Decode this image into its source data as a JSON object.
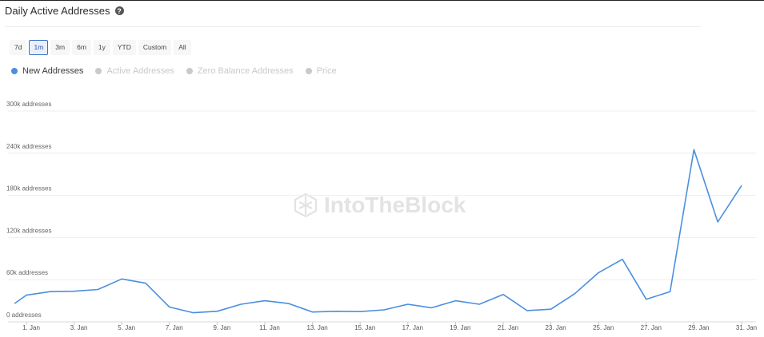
{
  "header": {
    "title": "Daily Active Addresses",
    "help_icon": "question-circle-icon",
    "help_glyph": "?"
  },
  "range_buttons": [
    {
      "label": "7d",
      "active": false
    },
    {
      "label": "1m",
      "active": true
    },
    {
      "label": "3m",
      "active": false
    },
    {
      "label": "6m",
      "active": false
    },
    {
      "label": "1y",
      "active": false
    },
    {
      "label": "YTD",
      "active": false
    },
    {
      "label": "Custom",
      "active": false
    },
    {
      "label": "All",
      "active": false
    }
  ],
  "legend": [
    {
      "label": "New Addresses",
      "color": "#4a8fe0",
      "active": true
    },
    {
      "label": "Active Addresses",
      "color": "#c9c9c9",
      "active": false
    },
    {
      "label": "Zero Balance Addresses",
      "color": "#c9c9c9",
      "active": false
    },
    {
      "label": "Price",
      "color": "#c9c9c9",
      "active": false
    }
  ],
  "watermark": {
    "text": "IntoTheBlock",
    "icon": "intotheblock-logo-icon"
  },
  "chart_data": {
    "type": "line",
    "title": "",
    "xlabel": "",
    "ylabel": "",
    "ylim": [
      0,
      300000
    ],
    "y_ticks": [
      {
        "value": 0,
        "label": "0 addresses"
      },
      {
        "value": 60000,
        "label": "60k addresses"
      },
      {
        "value": 120000,
        "label": "120k addresses"
      },
      {
        "value": 180000,
        "label": "180k addresses"
      },
      {
        "value": 240000,
        "label": "240k addresses"
      },
      {
        "value": 300000,
        "label": "300k addresses"
      }
    ],
    "x_tick_labels": [
      "1. Jan",
      "3. Jan",
      "5. Jan",
      "7. Jan",
      "9. Jan",
      "11. Jan",
      "13. Jan",
      "15. Jan",
      "17. Jan",
      "19. Jan",
      "21. Jan",
      "23. Jan",
      "25. Jan",
      "27. Jan",
      "29. Jan",
      "31. Jan"
    ],
    "x_tick_days": [
      1,
      3,
      5,
      7,
      9,
      11,
      13,
      15,
      17,
      19,
      21,
      23,
      25,
      27,
      29,
      31
    ],
    "grid": true,
    "series": [
      {
        "name": "New Addresses",
        "color": "#4a8fe0",
        "x": [
          0.5,
          1,
          2,
          3,
          4,
          5,
          6,
          7,
          8,
          9,
          10,
          11,
          12,
          13,
          14,
          15,
          16,
          17,
          18,
          19,
          20,
          21,
          22,
          23,
          24,
          25,
          26,
          27,
          28,
          29,
          30,
          31
        ],
        "y": [
          26000,
          38000,
          43000,
          43500,
          46000,
          61000,
          55000,
          21000,
          13000,
          15000,
          25000,
          30000,
          26000,
          14000,
          15000,
          14500,
          17000,
          25000,
          20000,
          30000,
          25000,
          39000,
          16000,
          18000,
          40000,
          70000,
          89000,
          32000,
          43000,
          245000,
          142000,
          194000
        ]
      }
    ]
  }
}
